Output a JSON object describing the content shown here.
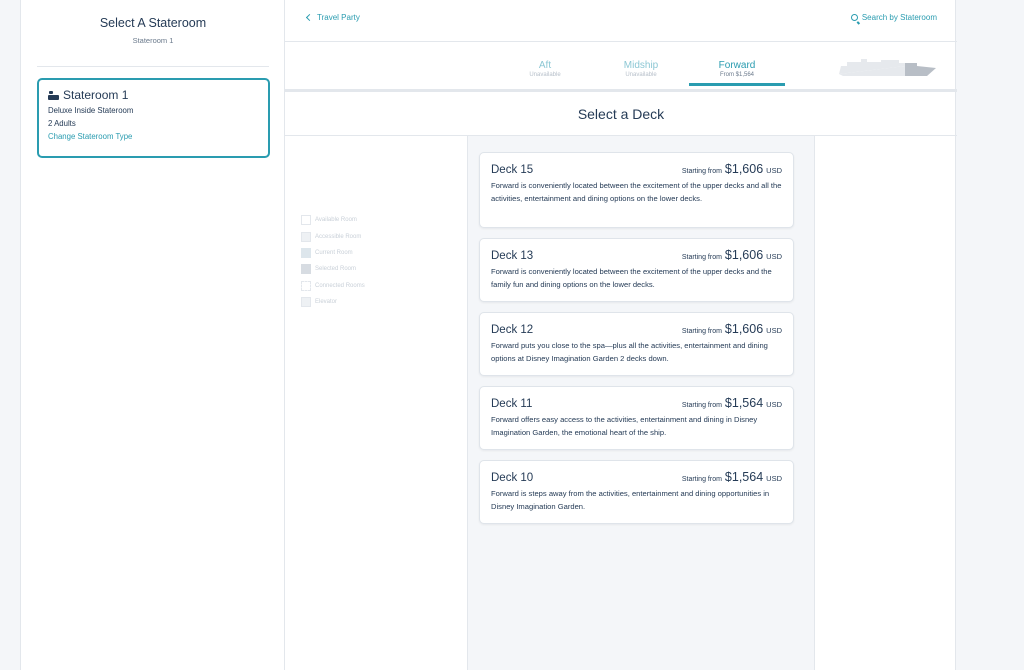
{
  "left_panel": {
    "title": "Select A Stateroom",
    "subtitle": "Stateroom 1",
    "room_card": {
      "name": "Stateroom 1",
      "type": "Deluxe Inside Stateroom",
      "guests": "2 Adults",
      "change_link": "Change Stateroom Type"
    }
  },
  "topbar": {
    "back_label": "Travel Party",
    "search_label": "Search by Stateroom"
  },
  "tabs": [
    {
      "label": "Aft",
      "sub": "Unavailable"
    },
    {
      "label": "Midship",
      "sub": "Unavailable"
    },
    {
      "label": "Forward",
      "sub": "From $1,564"
    }
  ],
  "active_tab": "Forward",
  "deck_header": "Select a Deck",
  "legend": [
    "Available Room",
    "Accessible Room",
    "Current Room",
    "Selected Room",
    "Connected Rooms",
    "Elevator"
  ],
  "price_prefix": "Starting from",
  "decks": [
    {
      "name": "Deck 15",
      "amount": "$1,606",
      "currency": "USD",
      "description": "Forward is conveniently located between the excitement of the upper decks and all the activities, entertainment and dining options on the lower decks."
    },
    {
      "name": "Deck 13",
      "amount": "$1,606",
      "currency": "USD",
      "description": "Forward is conveniently located between the excitement of the upper decks and the family fun and dining options on the lower decks."
    },
    {
      "name": "Deck 12",
      "amount": "$1,606",
      "currency": "USD",
      "description": "Forward puts you close to the spa—plus all the activities, entertainment and dining options at Disney Imagination Garden 2 decks down."
    },
    {
      "name": "Deck 11",
      "amount": "$1,564",
      "currency": "USD",
      "description": "Forward offers easy access to the activities, entertainment and dining in Disney Imagination Garden, the emotional heart of the ship."
    },
    {
      "name": "Deck 10",
      "amount": "$1,564",
      "currency": "USD",
      "description": "Forward is steps away from the activities, entertainment and dining opportunities in Disney Imagination Garden."
    }
  ],
  "colors": {
    "accent": "#2a9cb0",
    "text": "#253b56",
    "muted": "#6b7a8c",
    "border": "#e3e7ec"
  }
}
